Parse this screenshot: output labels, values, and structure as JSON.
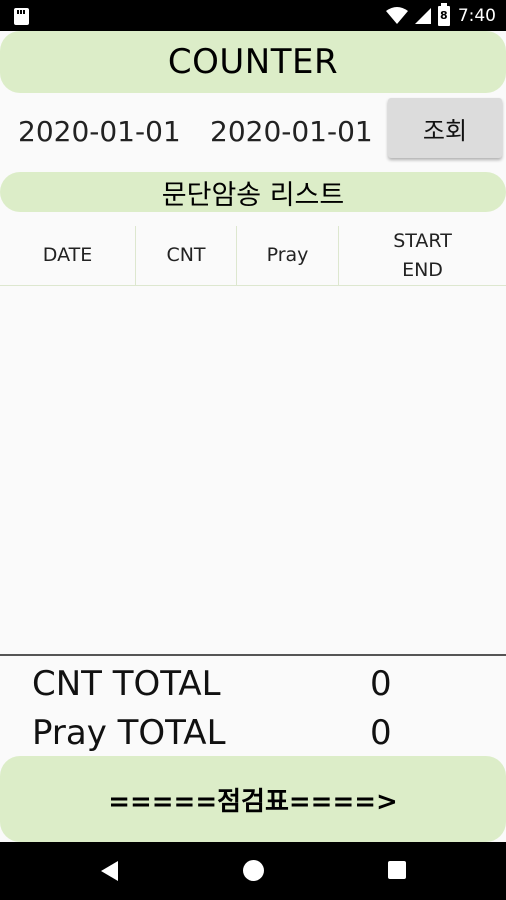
{
  "status_bar": {
    "time": "7:40",
    "battery": "8"
  },
  "app": {
    "title": "COUNTER"
  },
  "filter": {
    "start_date": "2020-01-01",
    "end_date": "2020-01-01",
    "search_label": "조회"
  },
  "list": {
    "title": "문단암송 리스트",
    "columns": {
      "date": "DATE",
      "cnt": "CNT",
      "pray": "Pray",
      "start": "START",
      "end": "END"
    },
    "rows": []
  },
  "totals": {
    "cnt_label": "CNT TOTAL",
    "cnt_value": "0",
    "pray_label": "Pray TOTAL",
    "pray_value": "0"
  },
  "checklist_button": {
    "label": "=====점검표====>"
  },
  "colors": {
    "accent": "#dcedc8",
    "button_gray": "#dcdcdc"
  }
}
